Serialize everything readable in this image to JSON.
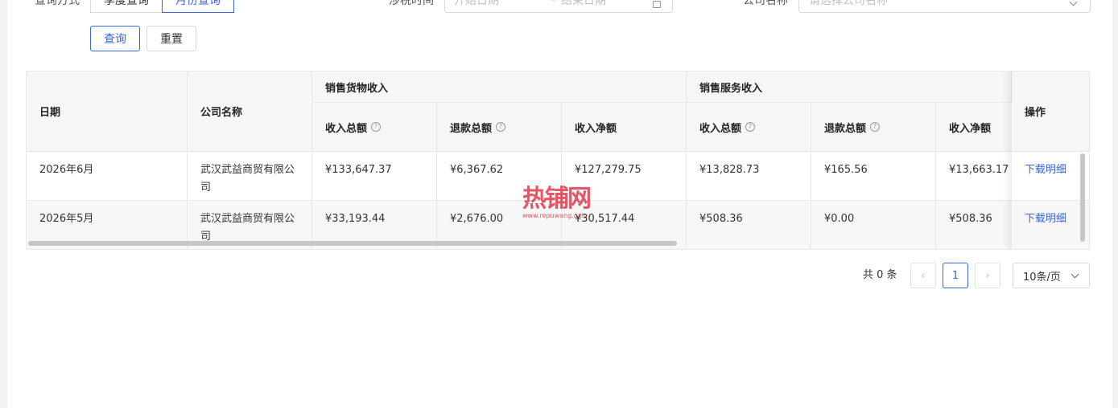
{
  "filters": {
    "query_mode_label": "查询方式",
    "mode_options": [
      "季度查询",
      "月份查询"
    ],
    "tax_period_label": "涉税时间",
    "start_date_placeholder": "开始日期",
    "date_separator": "-",
    "end_date_placeholder": "结束日期",
    "company_label": "公司名称",
    "company_placeholder": "请选择公司名称"
  },
  "actions": {
    "query_label": "查询",
    "reset_label": "重置"
  },
  "table": {
    "headers": {
      "date": "日期",
      "company": "公司名称",
      "goods_group": "销售货物收入",
      "service_group": "销售服务收入",
      "total_income": "收入总额",
      "total_refund": "退款总额",
      "net_income": "收入净额",
      "action": "操作"
    },
    "rows": [
      {
        "date": "2026年6月",
        "company": "武汉武益商贸有限公司",
        "goods_income": "¥133,647.37",
        "goods_refund": "¥6,367.62",
        "goods_net": "¥127,279.75",
        "service_income": "¥13,828.73",
        "service_refund": "¥165.56",
        "service_net": "¥13,663.17",
        "action": "下载明细"
      },
      {
        "date": "2026年5月",
        "company": "武汉武益商贸有限公司",
        "goods_income": "¥33,193.44",
        "goods_refund": "¥2,676.00",
        "goods_net": "¥30,517.44",
        "service_income": "¥508.36",
        "service_refund": "¥0.00",
        "service_net": "¥508.36",
        "action": "下载明细"
      }
    ]
  },
  "watermark": {
    "title": "热铺网",
    "url": "www.repuwang.com"
  },
  "pagination": {
    "total_text": "共 0 条",
    "prev_icon": "‹",
    "current_page": "1",
    "next_icon": "›",
    "page_size": "10条/页"
  },
  "colors": {
    "accent": "#3a66d6",
    "header_bg": "#f5f6f7",
    "watermark": "#dc283c"
  }
}
